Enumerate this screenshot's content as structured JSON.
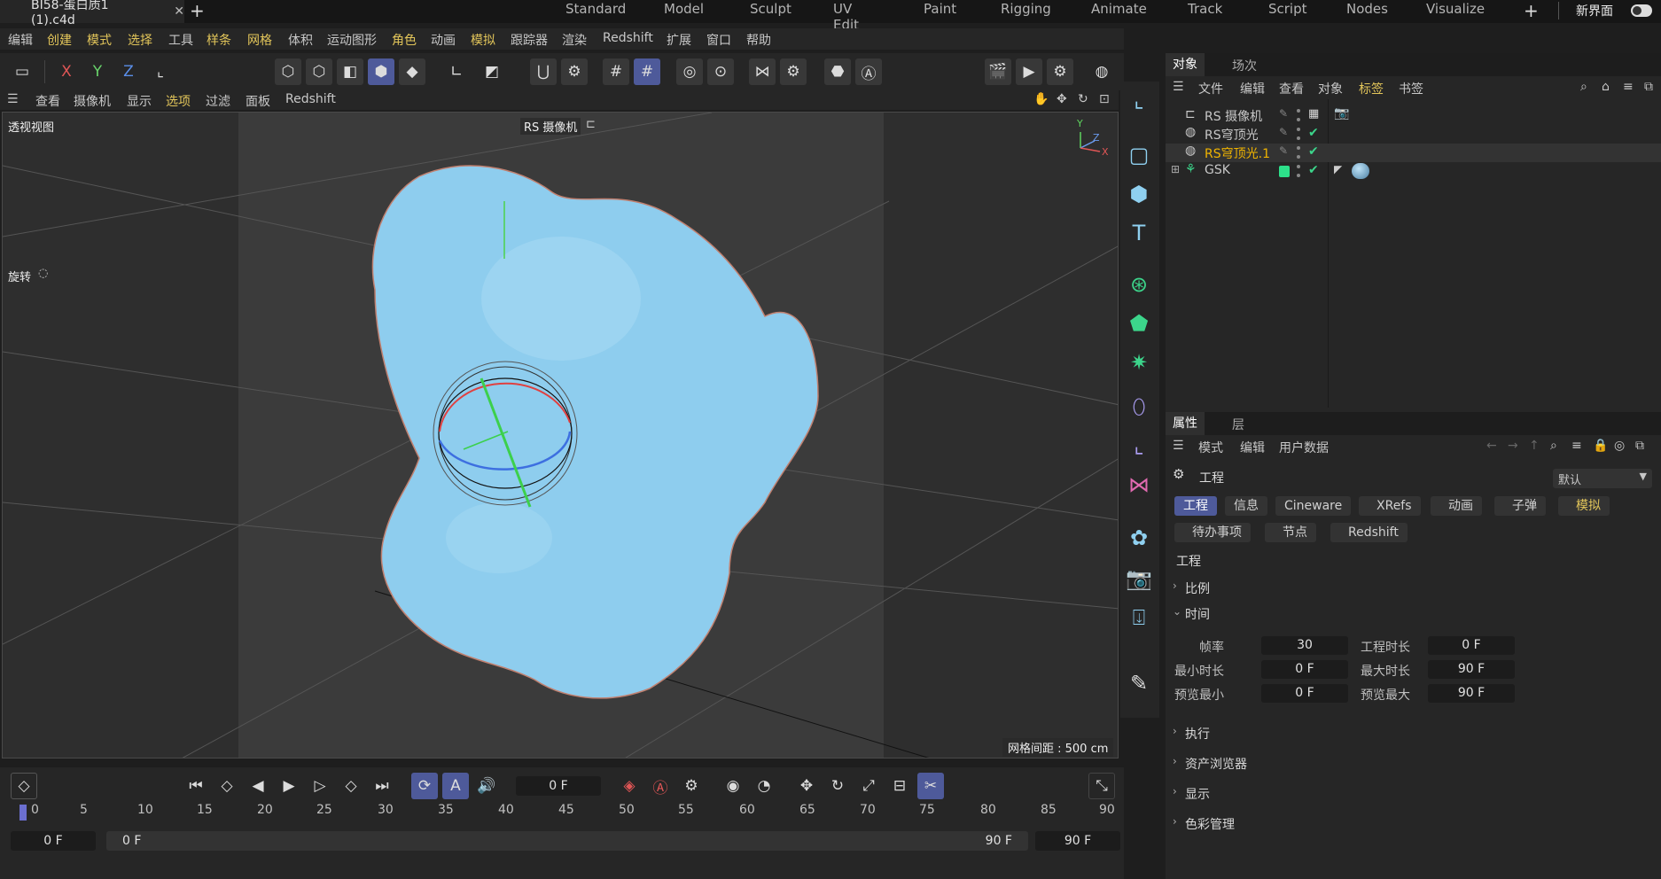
{
  "title_bar": {
    "file_tab": "BI58-蛋白质1 (1).c4d",
    "layouts": [
      "Standard",
      "Model",
      "Sculpt",
      "UV Edit",
      "Paint",
      "Rigging",
      "Animate",
      "Track",
      "Script",
      "Nodes",
      "Visualize"
    ],
    "new_layout": "新界面"
  },
  "menu": [
    "编辑",
    "创建",
    "模式",
    "选择",
    "工具",
    "样条",
    "网格",
    "体积",
    "运动图形",
    "角色",
    "动画",
    "模拟",
    "跟踪器",
    "渲染",
    "Redshift",
    "扩展",
    "窗口",
    "帮助"
  ],
  "axis_toggles": {
    "x": "X",
    "y": "Y",
    "z": "Z"
  },
  "viewport_menu": [
    "查看",
    "摄像机",
    "显示",
    "选项",
    "过滤",
    "面板",
    "Redshift"
  ],
  "viewport": {
    "view_name": "透视视图",
    "camera": "RS 摄像机",
    "mode": "旋转",
    "grid_spacing": "网格间距 : 500 cm",
    "axis_y": "Y",
    "axis_z": "Z",
    "axis_x": "X"
  },
  "objects_panel": {
    "tabs": [
      "对象",
      "场次"
    ],
    "menu": [
      "文件",
      "编辑",
      "查看",
      "对象",
      "标签",
      "书签"
    ],
    "items": [
      {
        "name": "RS 摄像机"
      },
      {
        "name": "RS穹顶光"
      },
      {
        "name": "RS穹顶光.1"
      },
      {
        "name": "GSK"
      }
    ]
  },
  "attributes": {
    "tabs": [
      "属性",
      "层"
    ],
    "menu": [
      "模式",
      "编辑",
      "用户数据"
    ],
    "object": "工程",
    "preset": "默认",
    "buttons_row1": [
      "工程",
      "信息",
      "Cineware",
      "XRefs",
      "动画",
      "子弹",
      "模拟"
    ],
    "buttons_row2": [
      "待办事项",
      "节点",
      "Redshift"
    ],
    "section_title": "工程",
    "groups": [
      "比例",
      "时间",
      "执行",
      "资产浏览器",
      "显示",
      "色彩管理"
    ],
    "time": {
      "fps_label": "帧率",
      "fps": "30",
      "len_label": "工程时长",
      "len": "0 F",
      "min_label": "最小时长",
      "min": "0 F",
      "max_label": "最大时长",
      "max": "90 F",
      "pmin_label": "预览最小",
      "pmin": "0 F",
      "pmax_label": "预览最大",
      "pmax": "90 F"
    }
  },
  "timeline": {
    "current_frame": "0 F",
    "ticks": [
      "0",
      "5",
      "10",
      "15",
      "20",
      "25",
      "30",
      "35",
      "40",
      "45",
      "50",
      "55",
      "60",
      "65",
      "70",
      "75",
      "80",
      "85",
      "90"
    ],
    "start": "0 F",
    "range_start": "0 F",
    "range_end": "90 F",
    "end": "90 F"
  },
  "colors": {
    "accent": "#4e5a9a",
    "highlight": "#e2c55a",
    "blob": "#8ecdee",
    "check": "#3cd58b"
  }
}
